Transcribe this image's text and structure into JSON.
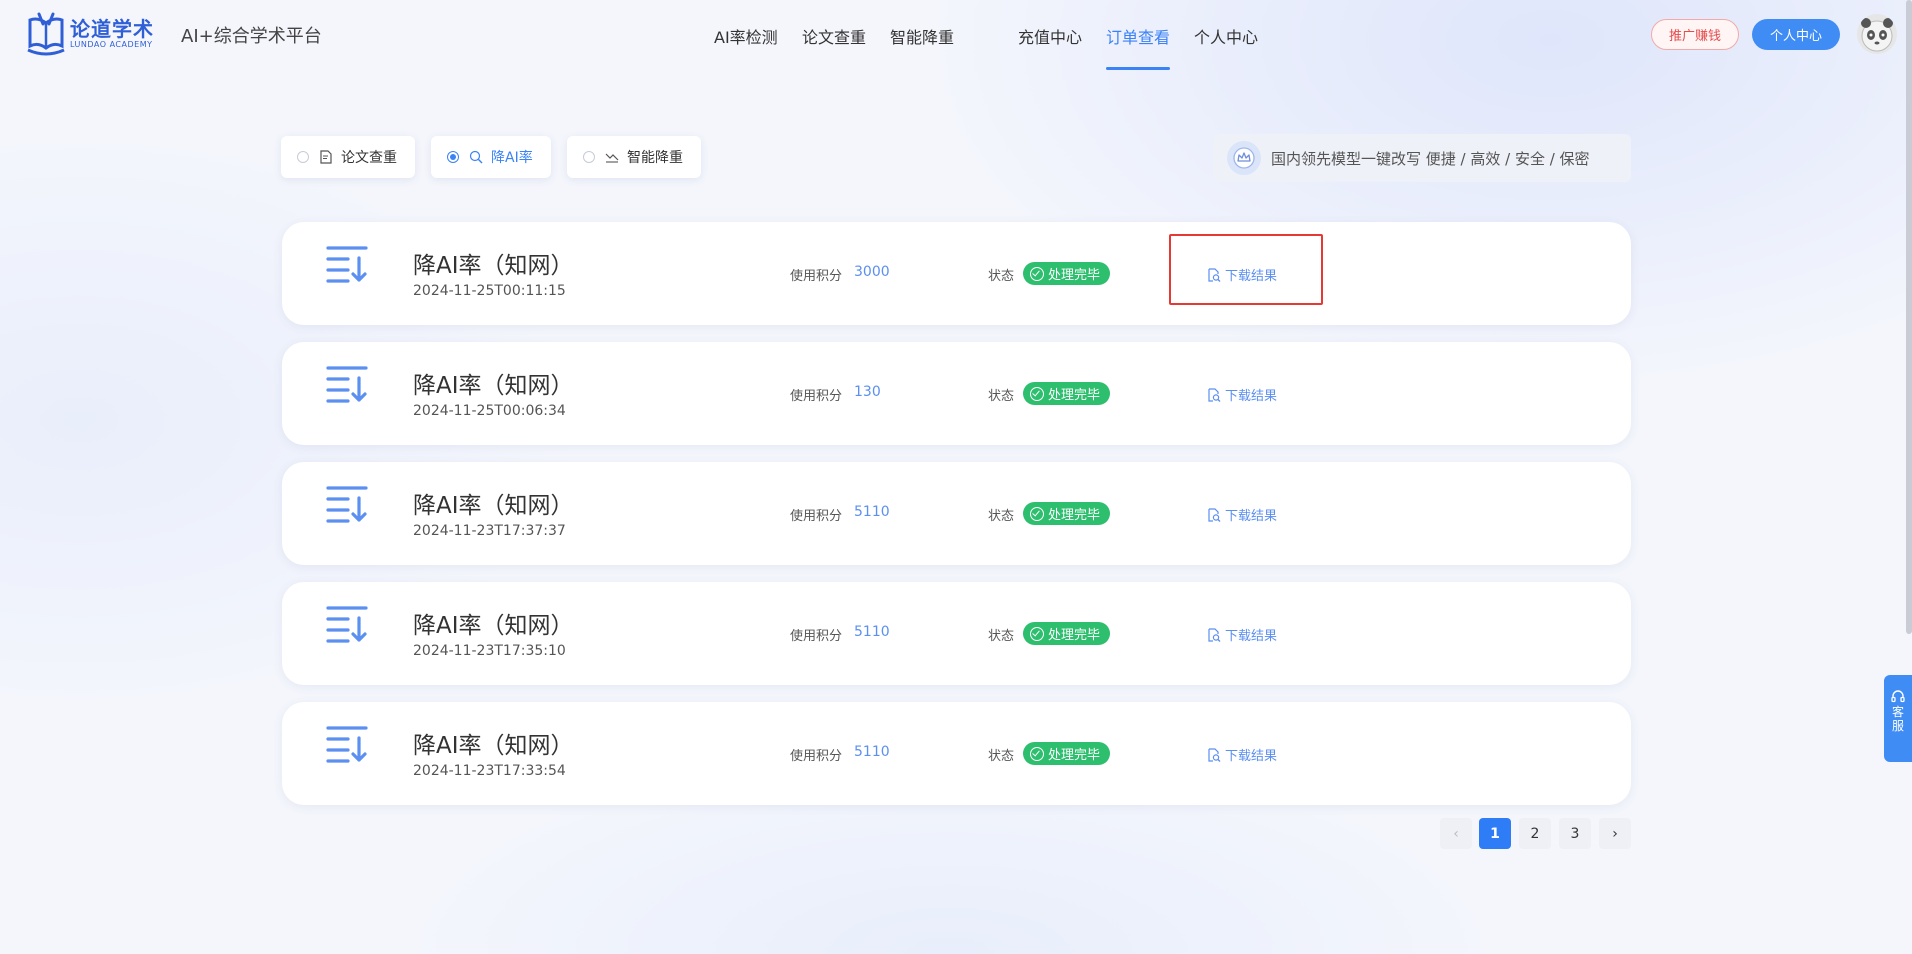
{
  "brand": {
    "logo_cn": "论道学术",
    "logo_en": "LUNDAO ACADEMY",
    "platform": "AI+综合学术平台"
  },
  "nav": {
    "items": [
      "AI率检测",
      "论文查重",
      "智能降重",
      "充值中心",
      "订单查看",
      "个人中心"
    ],
    "active": "订单查看"
  },
  "header_buttons": {
    "promo": "推广赚钱",
    "personal": "个人中心"
  },
  "filters": {
    "items": [
      "论文查重",
      "降AI率",
      "智能降重"
    ],
    "selected": "降AI率"
  },
  "banner": {
    "text": "国内领先模型一键改写 便捷 / 高效 / 安全 / 保密"
  },
  "orders": [
    {
      "title": "降AI率（知网）",
      "date": "2024-11-25T00:11:15",
      "points_label": "使用积分",
      "points": "3000",
      "status_label": "状态",
      "status": "处理完毕",
      "action": "下载结果"
    },
    {
      "title": "降AI率（知网）",
      "date": "2024-11-25T00:06:34",
      "points_label": "使用积分",
      "points": "130",
      "status_label": "状态",
      "status": "处理完毕",
      "action": "下载结果"
    },
    {
      "title": "降AI率（知网）",
      "date": "2024-11-23T17:37:37",
      "points_label": "使用积分",
      "points": "5110",
      "status_label": "状态",
      "status": "处理完毕",
      "action": "下载结果"
    },
    {
      "title": "降AI率（知网）",
      "date": "2024-11-23T17:35:10",
      "points_label": "使用积分",
      "points": "5110",
      "status_label": "状态",
      "status": "处理完毕",
      "action": "下载结果"
    },
    {
      "title": "降AI率（知网）",
      "date": "2024-11-23T17:33:54",
      "points_label": "使用积分",
      "points": "5110",
      "status_label": "状态",
      "status": "处理完毕",
      "action": "下载结果"
    }
  ],
  "pagination": {
    "prev": "‹",
    "pages": [
      "1",
      "2",
      "3"
    ],
    "current": "1",
    "next": "›"
  },
  "service": {
    "line1": "客",
    "line2": "服"
  },
  "colors": {
    "accent": "#3b82f6",
    "status_green": "#2dbf6e",
    "highlight_red": "#e53935"
  }
}
